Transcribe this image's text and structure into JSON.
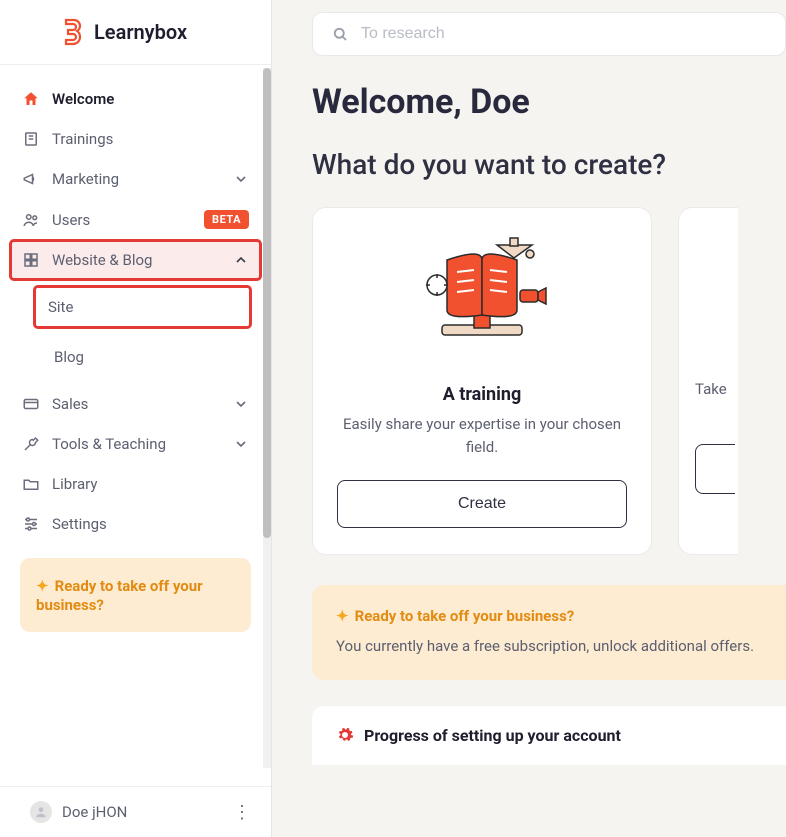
{
  "brand": {
    "name": "Learnybox"
  },
  "search": {
    "placeholder": "To research"
  },
  "nav": {
    "welcome": "Welcome",
    "trainings": "Trainings",
    "marketing": "Marketing",
    "users": "Users",
    "users_badge": "BETA",
    "website_blog": "Website & Blog",
    "site": "Site",
    "blog": "Blog",
    "sales": "Sales",
    "tools_teaching": "Tools & Teaching",
    "library": "Library",
    "settings": "Settings"
  },
  "promo": {
    "text": "Ready to take off your business?"
  },
  "user": {
    "name": "Doe jHON"
  },
  "main": {
    "greeting": "Welcome, Doe",
    "question": "What do you want to create?",
    "card1": {
      "title": "A training",
      "desc": "Easily share your expertise in your chosen field.",
      "button": "Create"
    },
    "card2_peek_desc": "Take",
    "banner": {
      "title": "Ready to take off your business?",
      "text": "You currently have a free subscription, unlock additional offers."
    },
    "progress": {
      "title": "Progress of setting up your account"
    }
  }
}
